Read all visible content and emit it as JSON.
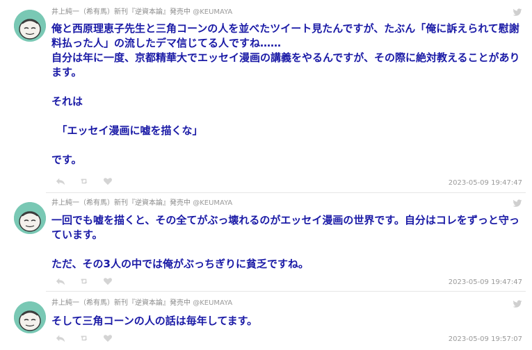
{
  "tweets": [
    {
      "author": "井上純一（希有馬）新刊『逆資本論』発売中",
      "handle": "@KEUMAYA",
      "text": "俺と西原理恵子先生と三角コーンの人を並べたツイート見たんですが、たぶん「俺に訴えられて慰謝料払った人」の流したデマ信じてる人ですね……\n自分は年に一度、京都精華大でエッセイ漫画の講義をやるんですが、その際に絶対教えることがあります。\n\nそれは\n\n　「エッセイ漫画に嘘を描くな」\n\nです。",
      "timestamp": "2023-05-09 19:47:47"
    },
    {
      "author": "井上純一（希有馬）新刊『逆資本論』発売中",
      "handle": "@KEUMAYA",
      "text": "一回でも嘘を描くと、その全てがぶっ壊れるのがエッセイ漫画の世界です。自分はコレをずっと守っています。\n\nただ、その3人の中では俺がぶっちぎりに貧乏ですね。",
      "timestamp": "2023-05-09 19:47:47"
    },
    {
      "author": "井上純一（希有馬）新刊『逆資本論』発売中",
      "handle": "@KEUMAYA",
      "text": "そして三角コーンの人の話は毎年してます。",
      "timestamp": "2023-05-09 19:57:07"
    }
  ],
  "icons": {
    "reply": "reply-icon",
    "retweet": "retweet-icon",
    "like": "heart-icon",
    "bird": "twitter-bird-icon"
  },
  "colors": {
    "text": "#1a1aa6",
    "meta": "#9a9a9a",
    "avatar_bg": "#79c8b4"
  }
}
